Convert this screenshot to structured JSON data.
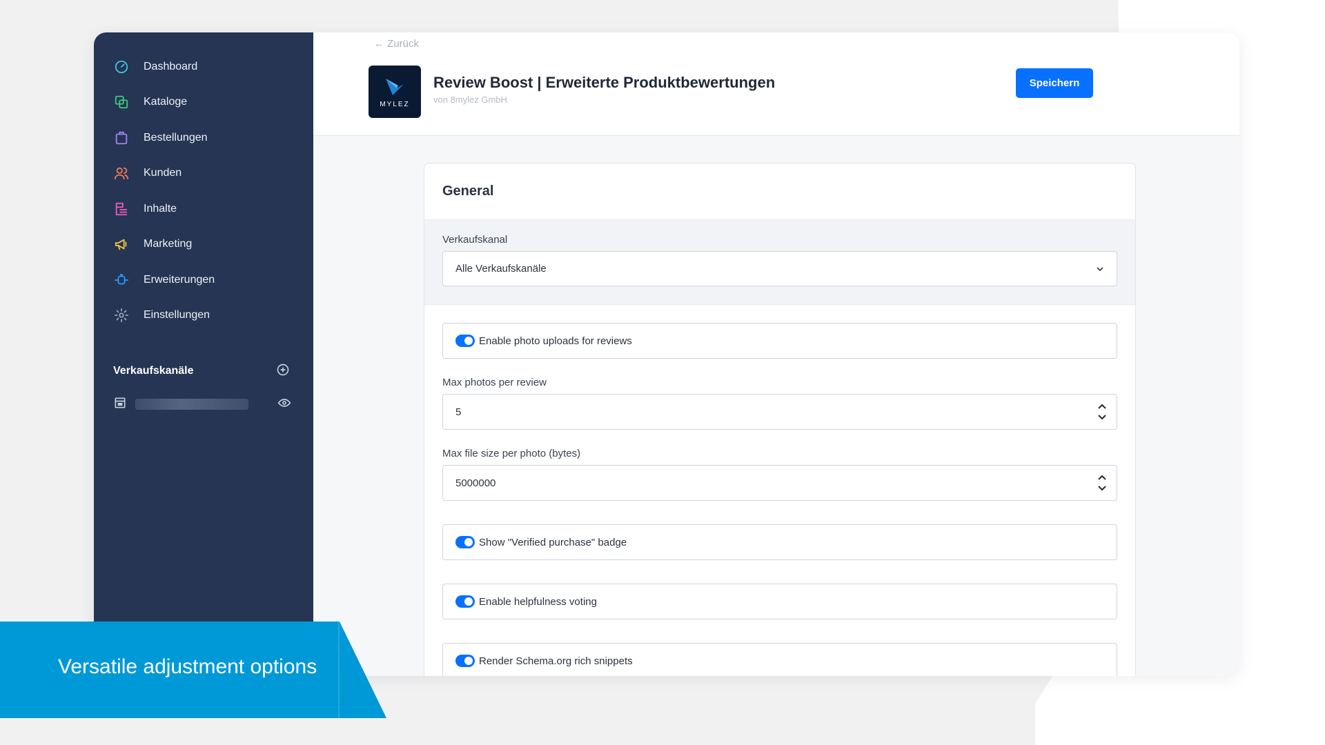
{
  "sidebar": {
    "nav": [
      {
        "label": "Dashboard",
        "icon": "gauge-icon",
        "color": "#3ec6e0"
      },
      {
        "label": "Kataloge",
        "icon": "catalog-icon",
        "color": "#3ec97b"
      },
      {
        "label": "Bestellungen",
        "icon": "bag-icon",
        "color": "#a682f5"
      },
      {
        "label": "Kunden",
        "icon": "users-icon",
        "color": "#f37a59"
      },
      {
        "label": "Inhalte",
        "icon": "content-icon",
        "color": "#e95dbd"
      },
      {
        "label": "Marketing",
        "icon": "megaphone-icon",
        "color": "#f6c443"
      },
      {
        "label": "Erweiterungen",
        "icon": "plugin-icon",
        "color": "#2f97f7"
      },
      {
        "label": "Einstellungen",
        "icon": "gear-icon",
        "color": "#9aa4b5"
      }
    ],
    "sales_channels_title": "Verkaufskanäle"
  },
  "header": {
    "back_label": "← Zurück",
    "logo_text": "MYLEZ",
    "title": "Review Boost | Erweiterte Produktbewertungen",
    "vendor": "von 8mylez GmbH",
    "save_label": "Speichern"
  },
  "card": {
    "title": "General",
    "sales_channel_label": "Verkaufskanal",
    "sales_channel_value": "Alle Verkaufskanäle",
    "photo_uploads_label": "Enable photo uploads for reviews",
    "max_photos_label": "Max photos per review",
    "max_photos_value": "5",
    "max_file_size_label": "Max file size per photo (bytes)",
    "max_file_size_value": "5000000",
    "verified_badge_label": "Show \"Verified purchase\" badge",
    "helpfulness_label": "Enable helpfulness voting",
    "schema_label": "Render Schema.org rich snippets"
  },
  "banner": {
    "text": "Versatile adjustment options"
  },
  "colors": {
    "sidebar_bg": "#253553",
    "primary": "#0870ff",
    "banner": "#0099d8"
  }
}
